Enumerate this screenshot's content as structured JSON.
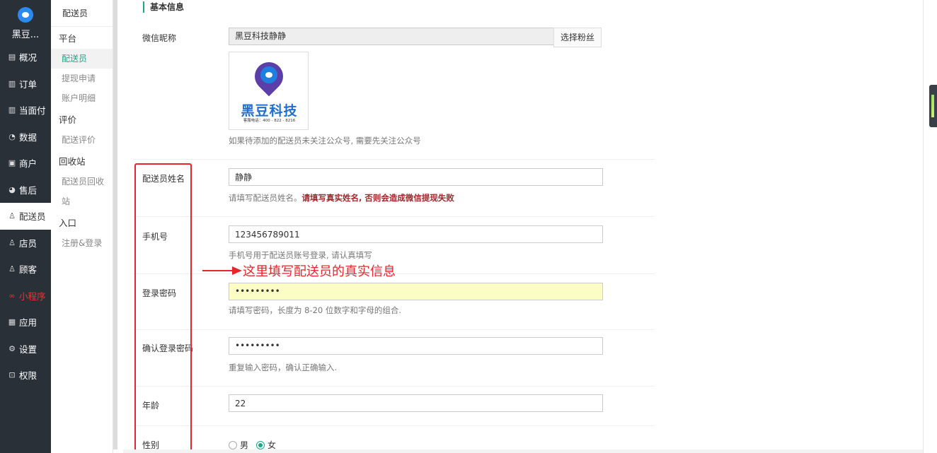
{
  "brand": {
    "name": "黑豆..."
  },
  "nav": [
    {
      "label": "概况",
      "icon": "overview-icon",
      "glyph": "▤"
    },
    {
      "label": "订单",
      "icon": "order-icon",
      "glyph": "▥"
    },
    {
      "label": "当面付",
      "icon": "pay-icon",
      "glyph": "▥"
    },
    {
      "label": "数据",
      "icon": "data-icon",
      "glyph": "◔"
    },
    {
      "label": "商户",
      "icon": "store-icon",
      "glyph": "▣"
    },
    {
      "label": "售后",
      "icon": "aftersale-icon",
      "glyph": "◕"
    },
    {
      "label": "配送员",
      "icon": "courier-icon",
      "glyph": "♙",
      "active": true
    },
    {
      "label": "店员",
      "icon": "clerk-icon",
      "glyph": "♙"
    },
    {
      "label": "顾客",
      "icon": "customer-icon",
      "glyph": "♙"
    },
    {
      "label": "小程序",
      "icon": "miniprogram-icon",
      "glyph": "∞",
      "red": true
    },
    {
      "label": "应用",
      "icon": "apps-icon",
      "glyph": "▦"
    },
    {
      "label": "设置",
      "icon": "settings-icon",
      "glyph": "⚙"
    },
    {
      "label": "权限",
      "icon": "lock-icon",
      "glyph": "⊡"
    }
  ],
  "subnav": {
    "title": "配送员",
    "groups": [
      {
        "label": "平台",
        "items": [
          "配送员",
          "提现申请",
          "账户明细"
        ]
      },
      {
        "label": "评价",
        "items": [
          "配送评价"
        ]
      },
      {
        "label": "回收站",
        "items": [
          "配送员回收站"
        ]
      },
      {
        "label": "入口",
        "items": [
          "注册&登录"
        ]
      }
    ]
  },
  "form": {
    "section_title": "基本信息",
    "wechat_label": "微信昵称",
    "wechat_value": "黑豆科技静静",
    "select_fans": "选择粉丝",
    "avatar_text": "黑豆科技",
    "avatar_sub": "客服电话：400 - 822 - 8216",
    "wechat_help": "如果待添加的配送员未关注公众号, 需要先关注公众号",
    "name_label": "配送员姓名",
    "name_value": "静静",
    "name_help": "请填写配送员姓名。",
    "name_warn": "请填写真实姓名, 否则会造成微信提现失败",
    "phone_label": "手机号",
    "phone_value": "123456789011",
    "phone_help": "手机号用于配送员账号登录, 请认真填写",
    "password_label": "登录密码",
    "password_value": "•••••••••",
    "password_help": "请填写密码，长度为 8-20 位数字和字母的组合.",
    "confirm_label": "确认登录密码",
    "confirm_value": "•••••••••",
    "confirm_help": "重复输入密码，确认正确输入.",
    "age_label": "年龄",
    "age_value": "22",
    "gender_label": "性别",
    "gender_male": "男",
    "gender_female": "女",
    "gender_selected": "女"
  },
  "annotation": {
    "text": "这里填写配送员的真实信息",
    "color": "#e5262a"
  },
  "colors": {
    "accent": "#1ba784",
    "nav_bg": "#2a3038",
    "warn": "#a0282a"
  }
}
